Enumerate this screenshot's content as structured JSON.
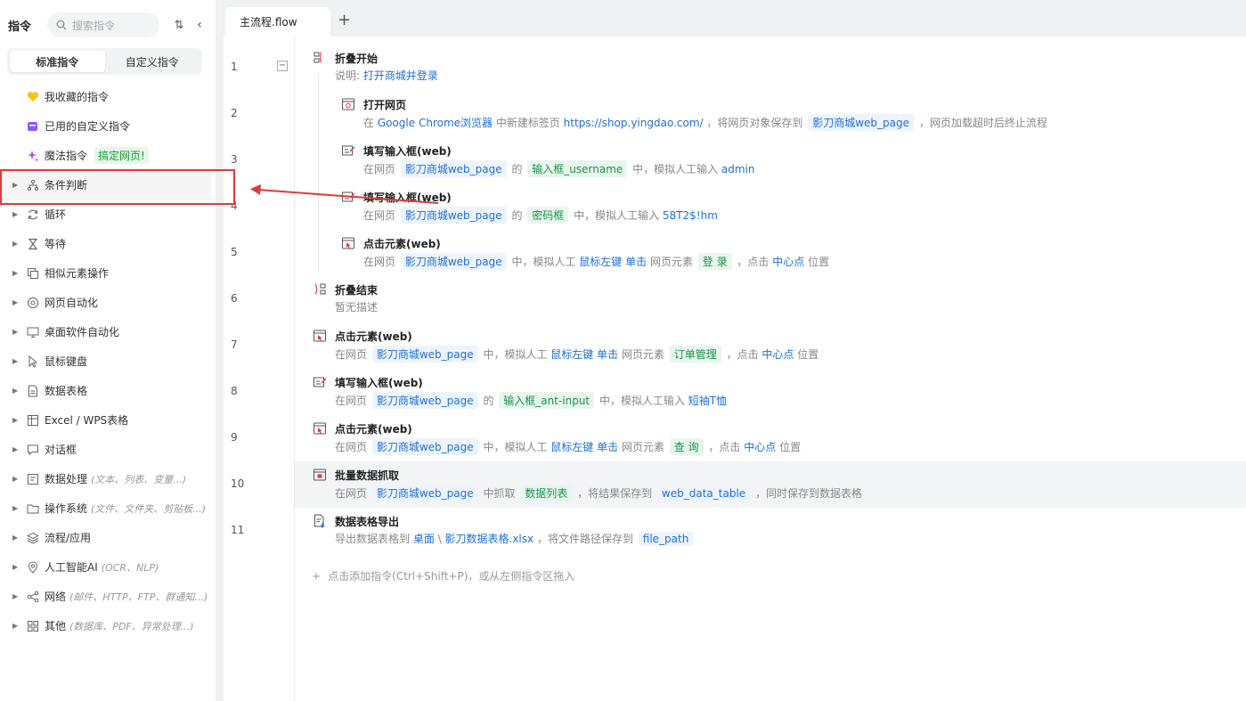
{
  "sidebar": {
    "title": "指令",
    "search_placeholder": "搜索指令",
    "tabs": [
      "标准指令",
      "自定义指令"
    ],
    "favorites": [
      {
        "label": "我收藏的指令",
        "icon": "heart-icon"
      },
      {
        "label": "已用的自定义指令",
        "icon": "calendar-icon"
      },
      {
        "label": "魔法指令",
        "icon": "sparkle-icon",
        "badge": "搞定网页!"
      }
    ],
    "categories": [
      {
        "label": "条件判断",
        "icon": "branch-icon",
        "sub": ""
      },
      {
        "label": "循环",
        "icon": "loop-icon",
        "sub": ""
      },
      {
        "label": "等待",
        "icon": "hourglass-icon",
        "sub": ""
      },
      {
        "label": "相似元素操作",
        "icon": "copy-icon",
        "sub": ""
      },
      {
        "label": "网页自动化",
        "icon": "browser-icon",
        "sub": ""
      },
      {
        "label": "桌面软件自动化",
        "icon": "monitor-icon",
        "sub": ""
      },
      {
        "label": "鼠标键盘",
        "icon": "mouse-icon",
        "sub": ""
      },
      {
        "label": "数据表格",
        "icon": "document-icon",
        "sub": ""
      },
      {
        "label": "Excel / WPS表格",
        "icon": "spreadsheet-icon",
        "sub": ""
      },
      {
        "label": "对话框",
        "icon": "dialog-icon",
        "sub": ""
      },
      {
        "label": "数据处理",
        "icon": "data-icon",
        "sub": "(文本、列表、变量...)"
      },
      {
        "label": "操作系统",
        "icon": "folder-icon",
        "sub": "(文件、文件夹、剪贴板...)"
      },
      {
        "label": "流程/应用",
        "icon": "layers-icon",
        "sub": ""
      },
      {
        "label": "人工智能AI",
        "icon": "ai-icon",
        "sub": "(OCR、NLP)"
      },
      {
        "label": "网络",
        "icon": "share-icon",
        "sub": "(邮件、HTTP、FTP、群通知...)"
      },
      {
        "label": "其他",
        "icon": "grid-icon",
        "sub": "(数据库、PDF、异常处理...)"
      }
    ]
  },
  "editor": {
    "file_tab": "主流程.flow",
    "add_tab": "+",
    "line_numbers": [
      "1",
      "2",
      "3",
      "4",
      "5",
      "6",
      "7",
      "8",
      "9",
      "10",
      "11"
    ],
    "fold_toggle": "−",
    "add_hint": "点击添加指令(Ctrl+Shift+P)，或从左侧指令区拖入",
    "add_hint_icon": "+",
    "statements": [
      {
        "title": "折叠开始",
        "desc": [
          [
            "t",
            "说明: "
          ],
          [
            "l",
            "打开商城并登录"
          ]
        ]
      },
      {
        "title": "打开网页",
        "desc": [
          [
            "t",
            "在 "
          ],
          [
            "l",
            "Google Chrome浏览器"
          ],
          [
            "t",
            " 中新建标签页 "
          ],
          [
            "l",
            "https://shop.yingdao.com/"
          ],
          [
            "t",
            " ，将网页对象保存到 "
          ],
          [
            "tag",
            "影刀商城web_page"
          ],
          [
            "t",
            " ，网页加载超时后终止流程"
          ]
        ]
      },
      {
        "title": "填写输入框(web)",
        "desc": [
          [
            "t",
            "在网页 "
          ],
          [
            "tag",
            "影刀商城web_page"
          ],
          [
            "t",
            " 的 "
          ],
          [
            "g",
            "输入框_username"
          ],
          [
            "t",
            " 中，模拟人工输入 "
          ],
          [
            "l",
            "admin"
          ]
        ]
      },
      {
        "title": "填写输入框(web)",
        "desc": [
          [
            "t",
            "在网页 "
          ],
          [
            "tag",
            "影刀商城web_page"
          ],
          [
            "t",
            " 的 "
          ],
          [
            "g",
            "密码框"
          ],
          [
            "t",
            " 中，模拟人工输入 "
          ],
          [
            "l",
            "58T2$!hm"
          ]
        ]
      },
      {
        "title": "点击元素(web)",
        "desc": [
          [
            "t",
            "在网页 "
          ],
          [
            "tag",
            "影刀商城web_page"
          ],
          [
            "t",
            " 中，模拟人工 "
          ],
          [
            "l",
            "鼠标左键"
          ],
          [
            "t",
            " "
          ],
          [
            "l",
            "单击"
          ],
          [
            "t",
            " 网页元素 "
          ],
          [
            "g",
            "登 录"
          ],
          [
            "t",
            " ，点击 "
          ],
          [
            "l",
            "中心点"
          ],
          [
            "t",
            " 位置"
          ]
        ]
      },
      {
        "title": "折叠结束",
        "desc": [
          [
            "t",
            "暂无描述"
          ]
        ]
      },
      {
        "title": "点击元素(web)",
        "desc": [
          [
            "t",
            "在网页 "
          ],
          [
            "tag",
            "影刀商城web_page"
          ],
          [
            "t",
            " 中，模拟人工 "
          ],
          [
            "l",
            "鼠标左键"
          ],
          [
            "t",
            " "
          ],
          [
            "l",
            "单击"
          ],
          [
            "t",
            " 网页元素 "
          ],
          [
            "g",
            "订单管理"
          ],
          [
            "t",
            " ，点击 "
          ],
          [
            "l",
            "中心点"
          ],
          [
            "t",
            " 位置"
          ]
        ]
      },
      {
        "title": "填写输入框(web)",
        "desc": [
          [
            "t",
            "在网页 "
          ],
          [
            "tag",
            "影刀商城web_page"
          ],
          [
            "t",
            " 的 "
          ],
          [
            "g",
            "输入框_ant-input"
          ],
          [
            "t",
            " 中，模拟人工输入 "
          ],
          [
            "l",
            "短袖T恤"
          ]
        ]
      },
      {
        "title": "点击元素(web)",
        "desc": [
          [
            "t",
            "在网页 "
          ],
          [
            "tag",
            "影刀商城web_page"
          ],
          [
            "t",
            " 中，模拟人工 "
          ],
          [
            "l",
            "鼠标左键"
          ],
          [
            "t",
            " "
          ],
          [
            "l",
            "单击"
          ],
          [
            "t",
            " 网页元素 "
          ],
          [
            "g",
            "查 询"
          ],
          [
            "t",
            " ，点击 "
          ],
          [
            "l",
            "中心点"
          ],
          [
            "t",
            " 位置"
          ]
        ]
      },
      {
        "title": "批量数据抓取",
        "desc": [
          [
            "t",
            "在网页 "
          ],
          [
            "tag",
            "影刀商城web_page"
          ],
          [
            "t",
            " 中抓取 "
          ],
          [
            "g",
            "数据列表"
          ],
          [
            "t",
            " ，将结果保存到 "
          ],
          [
            "tag",
            "web_data_table"
          ],
          [
            "t",
            " ，同时保存到数据表格"
          ]
        ]
      },
      {
        "title": "数据表格导出",
        "desc": [
          [
            "t",
            "导出数据表格到 "
          ],
          [
            "l",
            "桌面"
          ],
          [
            "t",
            " \\ "
          ],
          [
            "l",
            "影刀数据表格.xlsx"
          ],
          [
            "t",
            " ，将文件路径保存到 "
          ],
          [
            "tag",
            "file_path"
          ]
        ]
      }
    ]
  },
  "colors": {
    "accent": "#1e6fd9",
    "green": "#19934a",
    "annotation": "#e03a3a"
  }
}
